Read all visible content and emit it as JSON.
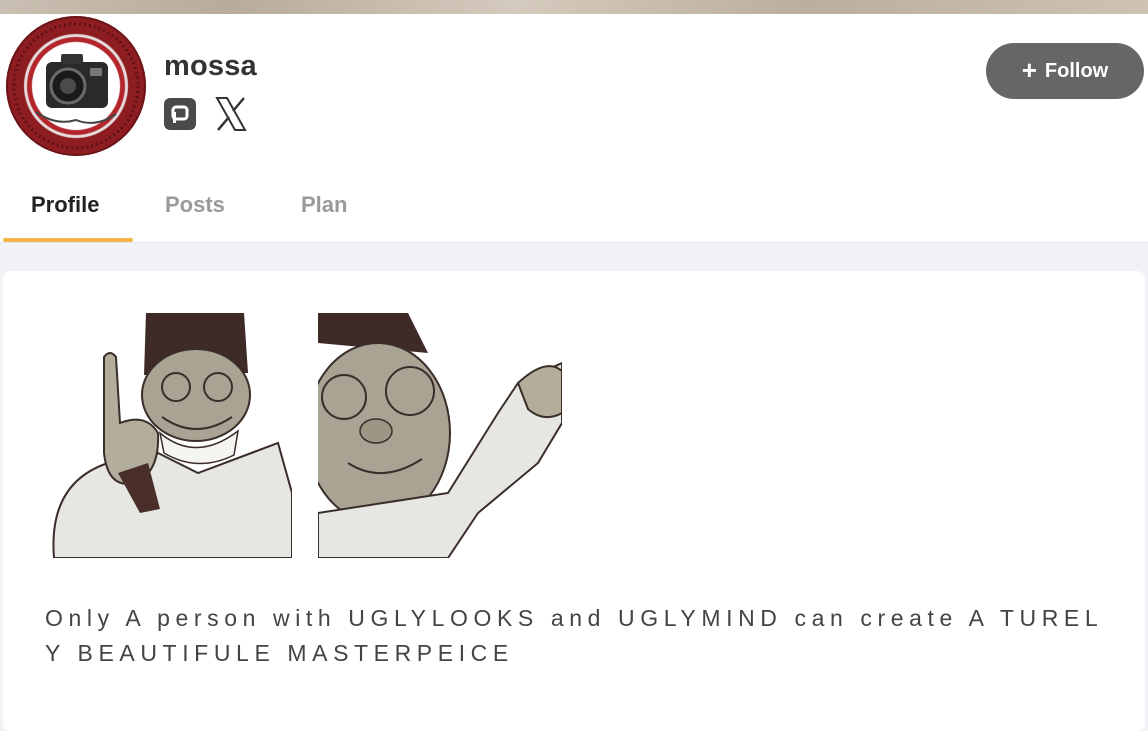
{
  "profile": {
    "username": "mossa",
    "follow_label": "Follow",
    "follow_icon": "plus-icon",
    "social_links": [
      {
        "icon": "pixiv-icon"
      },
      {
        "icon": "x-icon"
      }
    ]
  },
  "tabs": [
    {
      "label": "Profile",
      "active": true
    },
    {
      "label": "Posts",
      "active": false
    },
    {
      "label": "Plan",
      "active": false
    }
  ],
  "content": {
    "bio": "Only A person with UGLYLOOKS and UGLYMIND can create A TUREL Y BEAUTIFULE MASTERPEICE"
  },
  "colors": {
    "accent_tab_underline": "#f0b64a",
    "follow_button": "#666666",
    "page_background": "#f1f2f5"
  }
}
